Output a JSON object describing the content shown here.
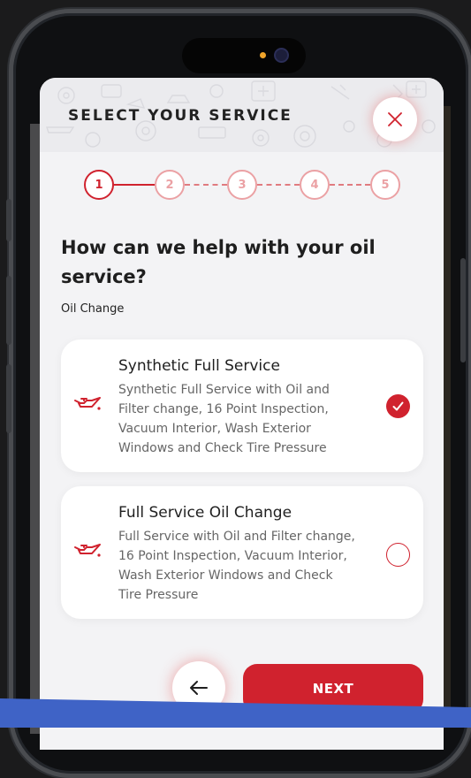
{
  "header": {
    "title": "SELECT YOUR SERVICE"
  },
  "stepper": {
    "steps": [
      "1",
      "2",
      "3",
      "4",
      "5"
    ],
    "current": 1
  },
  "question": "How can we help with your oil service?",
  "subtitle": "Oil Change",
  "services": [
    {
      "title": "Synthetic Full Service",
      "description": "Synthetic Full Service with Oil and Filter change, 16 Point Inspection, Vacuum Interior, Wash Exterior Windows and Check Tire Pressure",
      "selected": true
    },
    {
      "title": "Full Service Oil Change",
      "description": "Full Service with Oil and Filter change, 16 Point Inspection, Vacuum Interior, Wash Exterior Windows and Check Tire Pressure",
      "selected": false
    }
  ],
  "actions": {
    "next_label": "NEXT"
  },
  "icons": {
    "close": "close-icon",
    "back": "arrow-left-icon",
    "service": "oil-can-icon",
    "selected": "check-icon"
  },
  "colors": {
    "accent": "#d0222e",
    "accent_light": "#eba1a4",
    "sheet_bg": "#f3f3f5"
  }
}
